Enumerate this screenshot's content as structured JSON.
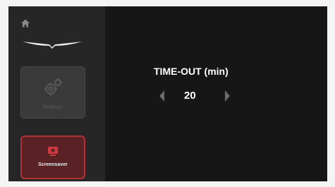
{
  "sidebar": {
    "home_icon": "home-icon",
    "logo_icon": "aircraft-wings-logo",
    "items": [
      {
        "label": "Settings",
        "icon": "gear-icon",
        "state": "disabled"
      },
      {
        "label": "Screensaver",
        "icon": "screensaver-icon",
        "state": "selected"
      }
    ]
  },
  "main": {
    "title": "TIME-OUT (min)",
    "value": "20"
  },
  "colors": {
    "background": "#161616",
    "sidebar": "#262626",
    "selected_fill": "#5b2226",
    "selected_border": "#b23037"
  }
}
